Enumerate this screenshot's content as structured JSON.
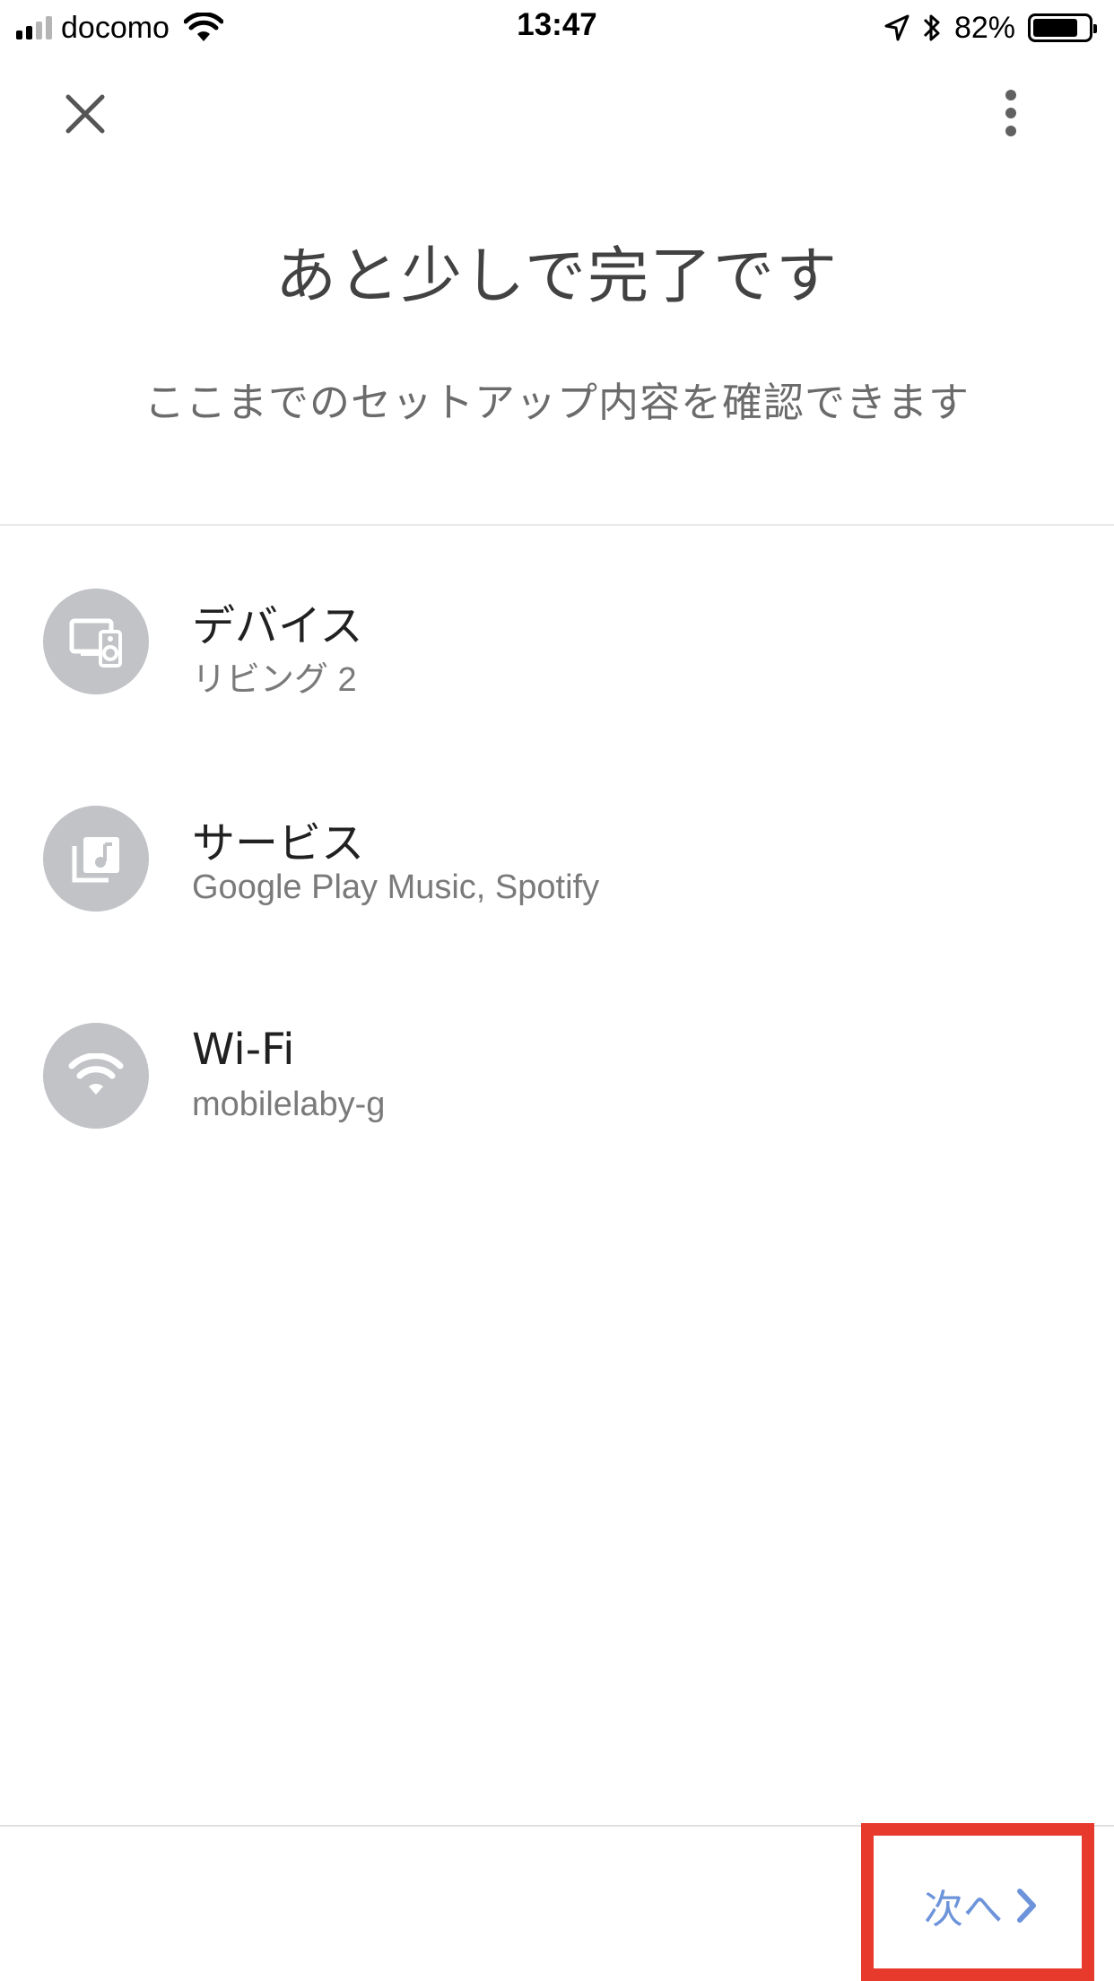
{
  "status_bar": {
    "carrier": "docomo",
    "time": "13:47",
    "battery": "82%",
    "battery_level": 0.82
  },
  "header": {
    "close_icon": "close-icon",
    "more_icon": "more-vert-icon"
  },
  "main": {
    "title": "あと少しで完了です",
    "subtitle": "ここまでのセットアップ内容を確認できます"
  },
  "summary": {
    "items": [
      {
        "label": "デバイス",
        "value": "リビング 2",
        "icon": "device-speaker-icon"
      },
      {
        "label": "サービス",
        "value": "Google Play Music, Spotify",
        "icon": "music-library-icon"
      },
      {
        "label": "Wi-Fi",
        "value": "mobilelaby-g",
        "icon": "wifi-icon"
      }
    ]
  },
  "footer": {
    "next_label": "次へ",
    "next_icon": "chevron-right-icon"
  },
  "colors": {
    "accent": "#6d94da",
    "highlight": "#e8392d",
    "icon_bg": "#c1c3c6"
  }
}
